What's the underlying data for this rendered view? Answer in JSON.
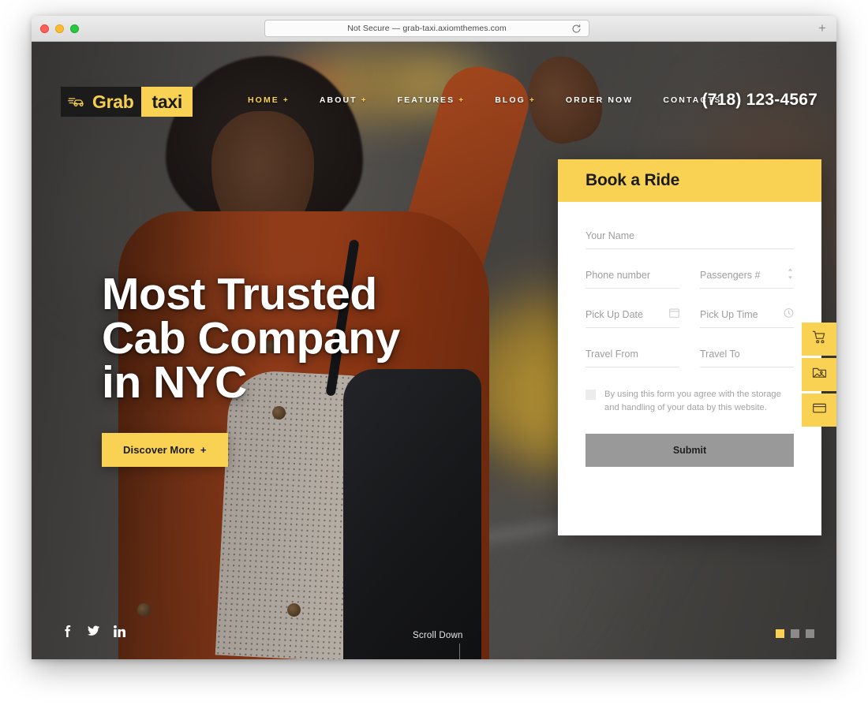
{
  "browser": {
    "url_text": "Not Secure — grab-taxi.axiomthemes.com",
    "reload_icon": "reload-icon",
    "new_tab_label": "+",
    "traffic_lights": [
      "close-red",
      "minimize-yellow",
      "maximize-green"
    ]
  },
  "site": {
    "logo": {
      "mark_icon": "taxi-car-icon",
      "word_primary": "Grab",
      "word_secondary": "taxi"
    },
    "nav": [
      {
        "label": "HOME",
        "has_dropdown": true,
        "active": true
      },
      {
        "label": "ABOUT",
        "has_dropdown": true,
        "active": false
      },
      {
        "label": "FEATURES",
        "has_dropdown": true,
        "active": false
      },
      {
        "label": "BLOG",
        "has_dropdown": true,
        "active": false
      },
      {
        "label": "ORDER NOW",
        "has_dropdown": false,
        "active": false
      },
      {
        "label": "CONTACTS",
        "has_dropdown": false,
        "active": false
      }
    ],
    "dropdown_glyph": "+",
    "phone": "(718) 123-4567"
  },
  "hero": {
    "title_line_1": "Most Trusted",
    "title_line_2": "Cab Company",
    "title_line_3": "in NYC",
    "cta_label": "Discover More",
    "cta_glyph": "+",
    "scroll_label": "Scroll Down"
  },
  "booking": {
    "title": "Book a Ride",
    "fields": {
      "name": {
        "placeholder": "Your Name",
        "value": ""
      },
      "phone": {
        "placeholder": "Phone number",
        "value": ""
      },
      "passengers": {
        "placeholder": "Passengers #",
        "value": "",
        "icon": "spinner-icon"
      },
      "pickup_date": {
        "placeholder": "Pick Up Date",
        "value": "",
        "icon": "calendar-icon"
      },
      "pickup_time": {
        "placeholder": "Pick Up Time",
        "value": "",
        "icon": "clock-icon"
      },
      "travel_from": {
        "placeholder": "Travel From",
        "value": ""
      },
      "travel_to": {
        "placeholder": "Travel To",
        "value": ""
      }
    },
    "consent_text": "By using this form you agree with the storage and handling of your data by this website.",
    "consent_checked": false,
    "submit_label": "Submit"
  },
  "side_buttons": [
    {
      "icon": "shopping-cart-icon",
      "name": "cart-button"
    },
    {
      "icon": "image-folder-icon",
      "name": "gallery-button"
    },
    {
      "icon": "window-icon",
      "name": "layout-button"
    }
  ],
  "socials": [
    {
      "icon": "facebook-icon",
      "label": "f"
    },
    {
      "icon": "twitter-icon",
      "label": "t"
    },
    {
      "icon": "linkedin-icon",
      "label": "in"
    }
  ],
  "slider": {
    "dots": 3,
    "active_index": 0
  },
  "colors": {
    "brand_yellow": "#f9d254",
    "dark": "#1b1b1b",
    "submit_grey": "#999999",
    "placeholder_grey": "#9d9d9d",
    "coat_orange": "#a8421a"
  }
}
